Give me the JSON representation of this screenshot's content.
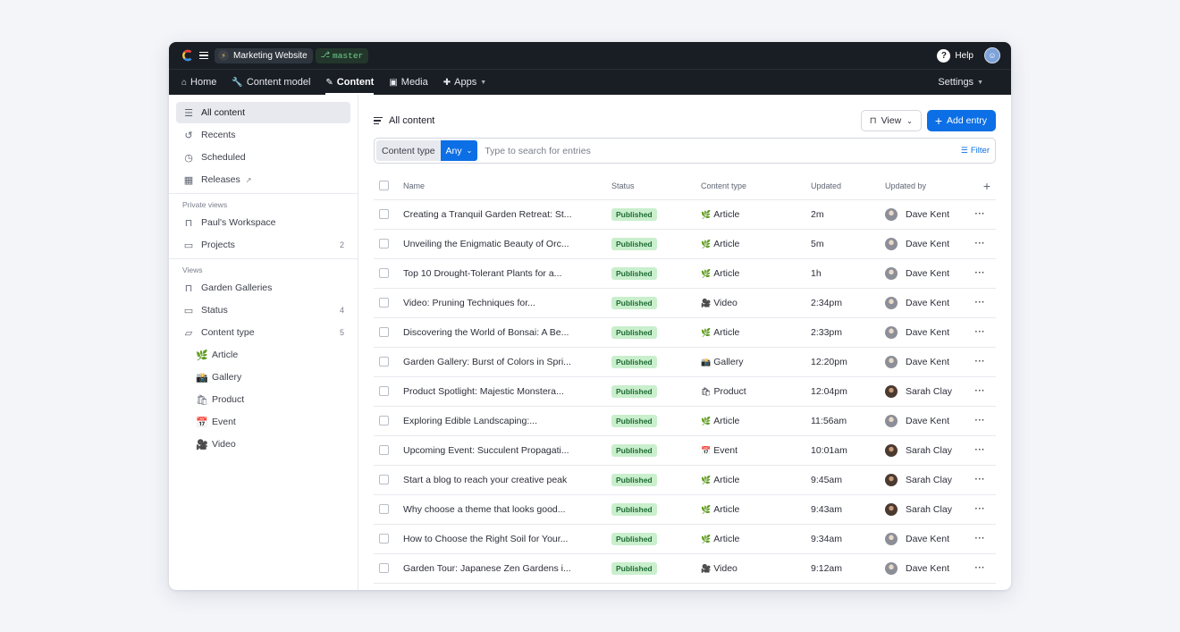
{
  "topbar": {
    "space_name": "Marketing Website",
    "environment": "master",
    "help_label": "Help"
  },
  "nav": {
    "items": [
      {
        "label": "Home",
        "icon": "home-icon"
      },
      {
        "label": "Content model",
        "icon": "wrench-icon"
      },
      {
        "label": "Content",
        "icon": "pencil-icon",
        "active": true
      },
      {
        "label": "Media",
        "icon": "image-icon"
      },
      {
        "label": "Apps",
        "icon": "puzzle-icon"
      }
    ],
    "settings_label": "Settings"
  },
  "sidebar": {
    "top_items": [
      {
        "label": "All content",
        "icon": "list-icon"
      },
      {
        "label": "Recents",
        "icon": "history-icon"
      },
      {
        "label": "Scheduled",
        "icon": "clock-icon"
      },
      {
        "label": "Releases",
        "icon": "calendar-icon"
      }
    ],
    "private_views_label": "Private views",
    "private_views": [
      {
        "label": "Paul's Workspace",
        "icon": "bookmark-icon",
        "count": ""
      },
      {
        "label": "Projects",
        "icon": "folder-icon",
        "count": "2"
      }
    ],
    "views_label": "Views",
    "views": [
      {
        "label": "Garden Galleries",
        "icon": "bookmark-icon",
        "count": ""
      },
      {
        "label": "Status",
        "icon": "folder-icon",
        "count": "4"
      },
      {
        "label": "Content type",
        "icon": "folder-open-icon",
        "count": "5"
      }
    ],
    "content_types": [
      {
        "label": "Article",
        "emoji": "🌿"
      },
      {
        "label": "Gallery",
        "emoji": "📸"
      },
      {
        "label": "Product",
        "emoji": "🛍"
      },
      {
        "label": "Event",
        "emoji": "📅"
      },
      {
        "label": "Video",
        "emoji": "🎥"
      }
    ]
  },
  "content": {
    "title": "All content",
    "view_label": "View",
    "add_entry_label": "Add entry",
    "filter_chip_label": "Content type",
    "filter_chip_value": "Any",
    "search_placeholder": "Type to search for entries",
    "filter_label": "Filter",
    "columns": [
      "Name",
      "Status",
      "Content type",
      "Updated",
      "Updated by"
    ],
    "rows": [
      {
        "name": "Creating a Tranquil Garden Retreat: St...",
        "status": "Published",
        "type": "Article",
        "type_emoji": "🌿",
        "updated": "2m",
        "by": "Dave Kent",
        "avatar": "dave"
      },
      {
        "name": "Unveiling the Enigmatic Beauty of Orc...",
        "status": "Published",
        "type": "Article",
        "type_emoji": "🌿",
        "updated": "5m",
        "by": "Dave Kent",
        "avatar": "dave"
      },
      {
        "name": "Top 10 Drought-Tolerant Plants for a...",
        "status": "Published",
        "type": "Article",
        "type_emoji": "🌿",
        "updated": "1h",
        "by": "Dave Kent",
        "avatar": "dave"
      },
      {
        "name": "Video: Pruning Techniques for...",
        "status": "Published",
        "type": "Video",
        "type_emoji": "🎥",
        "updated": "2:34pm",
        "by": "Dave Kent",
        "avatar": "dave"
      },
      {
        "name": "Discovering the World of Bonsai: A Be...",
        "status": "Published",
        "type": "Article",
        "type_emoji": "🌿",
        "updated": "2:33pm",
        "by": "Dave Kent",
        "avatar": "dave"
      },
      {
        "name": "Garden Gallery: Burst of Colors in Spri...",
        "status": "Published",
        "type": "Gallery",
        "type_emoji": "📸",
        "updated": "12:20pm",
        "by": "Dave Kent",
        "avatar": "dave"
      },
      {
        "name": "Product Spotlight: Majestic Monstera...",
        "status": "Published",
        "type": "Product",
        "type_emoji": "🛍",
        "updated": "12:04pm",
        "by": "Sarah Clay",
        "avatar": "sarah"
      },
      {
        "name": "Exploring Edible Landscaping:...",
        "status": "Published",
        "type": "Article",
        "type_emoji": "🌿",
        "updated": "11:56am",
        "by": "Dave Kent",
        "avatar": "dave"
      },
      {
        "name": "Upcoming Event: Succulent Propagati...",
        "status": "Published",
        "type": "Event",
        "type_emoji": "📅",
        "updated": "10:01am",
        "by": "Sarah Clay",
        "avatar": "sarah"
      },
      {
        "name": "Start a blog to reach your creative peak",
        "status": "Published",
        "type": "Article",
        "type_emoji": "🌿",
        "updated": "9:45am",
        "by": "Sarah Clay",
        "avatar": "sarah"
      },
      {
        "name": "Why choose a theme that looks good...",
        "status": "Published",
        "type": "Article",
        "type_emoji": "🌿",
        "updated": "9:43am",
        "by": "Sarah Clay",
        "avatar": "sarah"
      },
      {
        "name": "How to Choose the Right Soil for Your...",
        "status": "Published",
        "type": "Article",
        "type_emoji": "🌿",
        "updated": "9:34am",
        "by": "Dave Kent",
        "avatar": "dave"
      },
      {
        "name": "Garden Tour: Japanese Zen Gardens i...",
        "status": "Published",
        "type": "Video",
        "type_emoji": "🎥",
        "updated": "9:12am",
        "by": "Dave Kent",
        "avatar": "dave"
      }
    ]
  },
  "colors": {
    "accent": "#0c6fe6",
    "topbar_bg": "#191e24",
    "published_badge_bg": "#c9efcd",
    "published_badge_fg": "#1f6b33"
  }
}
